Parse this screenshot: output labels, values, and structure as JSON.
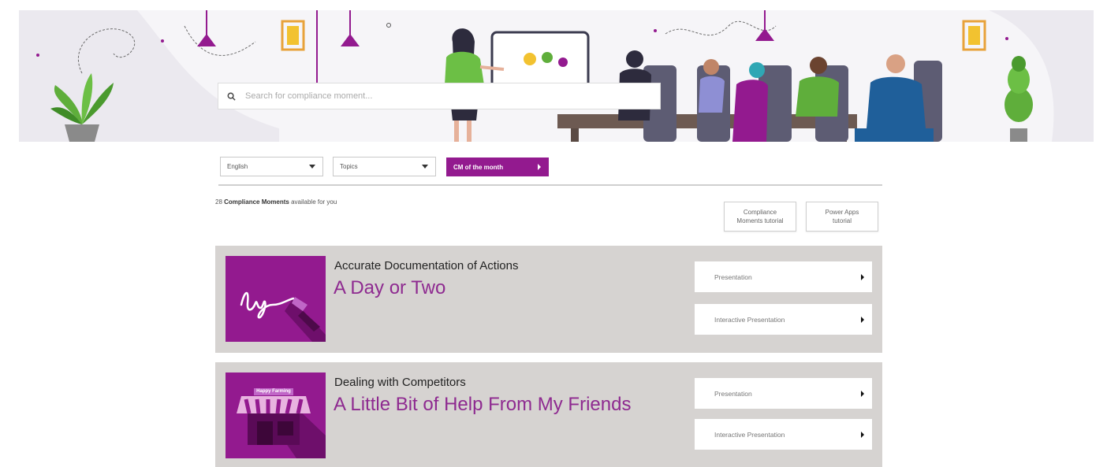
{
  "search": {
    "placeholder": "Search for compliance moment..."
  },
  "filters": {
    "language": "English",
    "topics": "Topics",
    "cm_of_month": "CM of the month"
  },
  "count": {
    "prefix": "28",
    "bold": "Compliance Moments",
    "suffix": "available for you"
  },
  "tutorials": [
    {
      "line1": "Compliance",
      "line2": "Moments tutorial"
    },
    {
      "line1": "Power Apps",
      "line2": "tutorial"
    }
  ],
  "cards": [
    {
      "topic": "Accurate Documentation of Actions",
      "title": "A Day or Two",
      "actions": [
        "Presentation",
        "Interactive Presentation"
      ]
    },
    {
      "topic": "Dealing with Competitors",
      "title": "A Little Bit of Help From My Friends",
      "sign": "Happy Farming",
      "actions": [
        "Presentation",
        "Interactive Presentation"
      ]
    }
  ],
  "colors": {
    "accent": "#931a8f",
    "card_bg": "#d6d3d1",
    "hero_bg": "#ebe9ef"
  }
}
